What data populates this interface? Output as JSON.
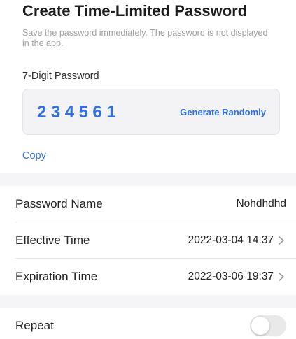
{
  "header": {
    "title": "Create Time-Limited Password",
    "subtitle": "Save the password immediately. The password is not displayed in the app."
  },
  "password": {
    "label": "7-Digit Password",
    "digits": "234561",
    "generate_label": "Generate Randomly",
    "copy_label": "Copy"
  },
  "settings": {
    "name": {
      "label": "Password Name",
      "value": "Nohdhdhd"
    },
    "effective": {
      "label": "Effective Time",
      "value": "2022-03-04 14:37"
    },
    "expiration": {
      "label": "Expiration Time",
      "value": "2022-03-06 19:37"
    },
    "repeat": {
      "label": "Repeat",
      "enabled": false
    }
  },
  "icons": {
    "chevron": "chevron-right-icon",
    "toggle": "toggle-switch"
  },
  "colors": {
    "accent": "#2f6fde",
    "muted_text": "#a0a0a0",
    "section_background": "#f5f5f7",
    "toggle_off": "#e9e9ea"
  }
}
